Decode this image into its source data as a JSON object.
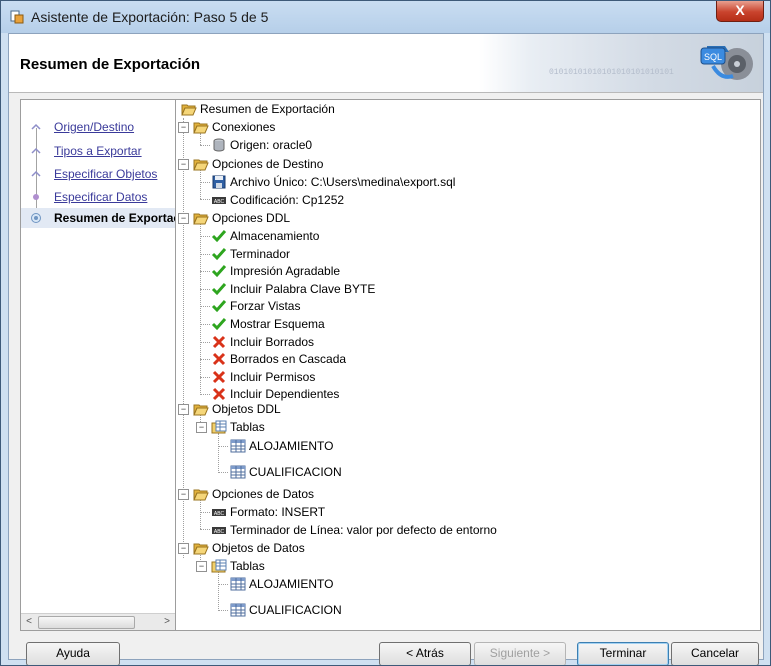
{
  "window": {
    "title": "Asistente de Exportación: Paso 5 de 5",
    "close_label": "X"
  },
  "header": {
    "title": "Resumen de Exportación",
    "binary": "01010101010101010101010101",
    "badge": "SQL"
  },
  "nav": {
    "items": [
      {
        "label": "Origen/Destino",
        "active": false
      },
      {
        "label": "Tipos a Exportar",
        "active": false
      },
      {
        "label": "Especificar Objetos",
        "active": false
      },
      {
        "label": "Especificar Datos",
        "active": false
      },
      {
        "label": "Resumen de Exportación",
        "active": true
      }
    ]
  },
  "tree": {
    "root": "Resumen de Exportación",
    "conexiones": {
      "label": "Conexiones",
      "origen": "Origen: oracle0"
    },
    "destino": {
      "label": "Opciones de Destino",
      "archivo": "Archivo Único: C:\\Users\\medina\\export.sql",
      "codificacion": "Codificación: Cp1252"
    },
    "ddl": {
      "label": "Opciones DDL",
      "items": [
        {
          "label": "Almacenamiento",
          "enabled": true
        },
        {
          "label": "Terminador",
          "enabled": true
        },
        {
          "label": "Impresión Agradable",
          "enabled": true
        },
        {
          "label": "Incluir Palabra Clave BYTE",
          "enabled": true
        },
        {
          "label": "Forzar Vistas",
          "enabled": true
        },
        {
          "label": "Mostrar Esquema",
          "enabled": true
        },
        {
          "label": "Incluir Borrados",
          "enabled": false
        },
        {
          "label": "Borrados en Cascada",
          "enabled": false
        },
        {
          "label": "Incluir Permisos",
          "enabled": false
        },
        {
          "label": "Incluir Dependientes",
          "enabled": false
        }
      ]
    },
    "objetos_ddl": {
      "label": "Objetos DDL",
      "tablas": "Tablas",
      "items": [
        "ALOJAMIENTO",
        "CUALIFICACION"
      ]
    },
    "datos": {
      "label": "Opciones de Datos",
      "formato": "Formato: INSERT",
      "terminador": "Terminador de Línea: valor por defecto de entorno"
    },
    "objetos_datos": {
      "label": "Objetos de Datos",
      "tablas": "Tablas",
      "items": [
        "ALOJAMIENTO",
        "CUALIFICACION"
      ]
    }
  },
  "buttons": {
    "help": "Ayuda",
    "back": "< Atrás",
    "next": "Siguiente >",
    "finish": "Terminar",
    "cancel": "Cancelar"
  },
  "colors": {
    "check": "#2ea51f",
    "cross": "#d93219",
    "link": "#3a3a9a",
    "folder": "#f5c84a"
  }
}
